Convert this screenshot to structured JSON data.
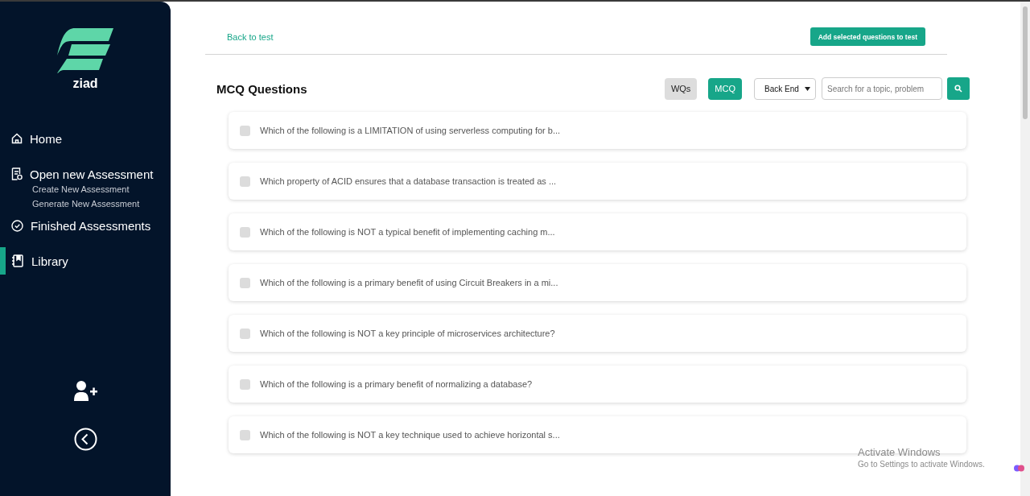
{
  "sidebar": {
    "brand": "ziad",
    "items": [
      {
        "label": "Home",
        "selected": false
      },
      {
        "label": "Open new Assessment",
        "selected": false,
        "children": [
          {
            "label": "Create New Assessment"
          },
          {
            "label": "Generate New Assessment"
          }
        ]
      },
      {
        "label": "Finished Assessments",
        "selected": false
      },
      {
        "label": "Library",
        "selected": true
      }
    ]
  },
  "header": {
    "back_link": "Back to test",
    "add_button": "Add selected questions to test"
  },
  "section": {
    "title": "MCQ Questions",
    "toggles": [
      {
        "label": "WQs",
        "selected": false
      },
      {
        "label": "MCQ",
        "selected": true
      }
    ],
    "category_select": "Back End",
    "search": {
      "placeholder": "Search for a topic, problem"
    }
  },
  "questions": [
    {
      "text": "Which of the following is a LIMITATION of using serverless computing for b...",
      "checked": false
    },
    {
      "text": "Which property of ACID ensures that a database transaction is treated as ...",
      "checked": false
    },
    {
      "text": "Which of the following is NOT a typical benefit of implementing caching m...",
      "checked": false
    },
    {
      "text": "Which of the following is a primary benefit of using Circuit Breakers in a mi...",
      "checked": false
    },
    {
      "text": "Which of the following is NOT a key principle of microservices architecture?",
      "checked": false
    },
    {
      "text": "Which of the following is a primary benefit of normalizing a database?",
      "checked": false
    },
    {
      "text": "Which of the following is NOT a key technique used to achieve horizontal s...",
      "checked": false
    }
  ],
  "windows_notice": {
    "title": "Activate Windows",
    "subtitle": "Go to Settings to activate Windows."
  }
}
